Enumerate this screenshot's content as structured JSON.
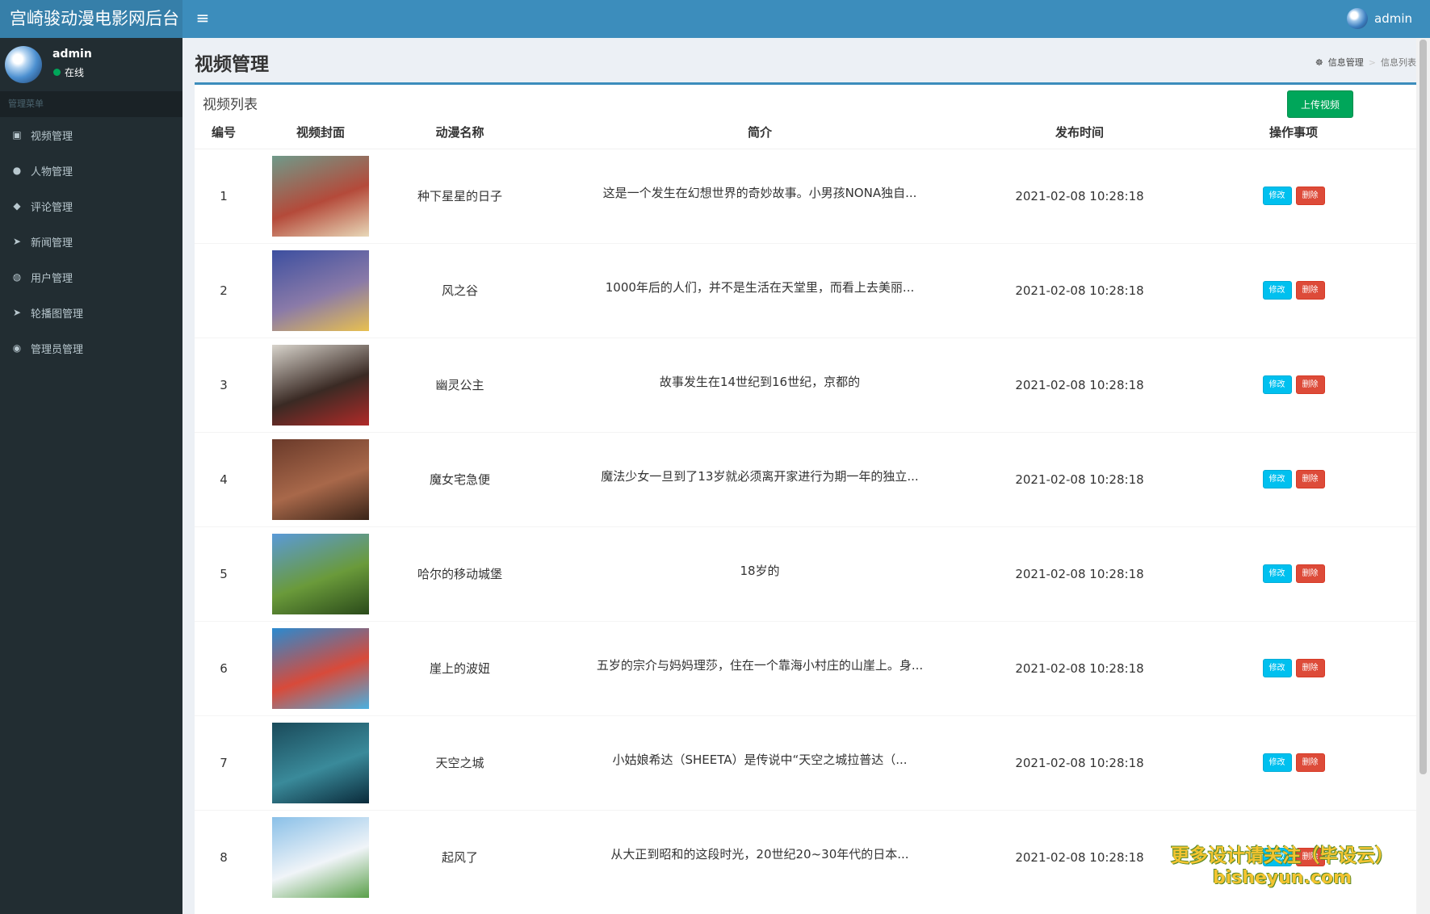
{
  "app": {
    "title": "宫崎骏动漫电影网后台"
  },
  "topbar": {
    "user_name": "admin"
  },
  "sidebar": {
    "user": {
      "name": "admin",
      "status": "在线"
    },
    "menu_header": "管理菜单",
    "items": [
      {
        "label": "视频管理",
        "icon": "film-icon",
        "glyph": "▣"
      },
      {
        "label": "人物管理",
        "icon": "user-icon",
        "glyph": "●"
      },
      {
        "label": "评论管理",
        "icon": "comments-icon",
        "glyph": "◆"
      },
      {
        "label": "新闻管理",
        "icon": "paper-plane-icon",
        "glyph": "➤"
      },
      {
        "label": "用户管理",
        "icon": "users-icon",
        "glyph": "◍"
      },
      {
        "label": "轮播图管理",
        "icon": "paper-plane-icon",
        "glyph": "➤"
      },
      {
        "label": "管理员管理",
        "icon": "user-circle-icon",
        "glyph": "◉"
      }
    ]
  },
  "page": {
    "title": "视频管理",
    "breadcrumb": [
      "信息管理",
      "信息列表"
    ]
  },
  "box": {
    "title": "视频列表",
    "upload_label": "上传视频"
  },
  "table": {
    "headers": [
      "编号",
      "视频封面",
      "动漫名称",
      "简介",
      "发布时间",
      "操作事项"
    ],
    "edit_label": "修改",
    "delete_label": "删除",
    "rows": [
      {
        "id": "1",
        "name": "种下星星的日子",
        "intro": "这是一个发生在幻想世界的奇妙故事。小男孩NONA独自...",
        "time": "2021-02-08 10:28:18",
        "cover_colors": [
          "#6f9a8a",
          "#b44a3a",
          "#e8d8b8"
        ]
      },
      {
        "id": "2",
        "name": "风之谷",
        "intro": "1000年后的人们，并不是生活在天堂里，而看上去美丽...",
        "time": "2021-02-08 10:28:18",
        "cover_colors": [
          "#3c4fa0",
          "#8a7aa8",
          "#e8c050"
        ]
      },
      {
        "id": "3",
        "name": "幽灵公主",
        "intro": "故事发生在14世纪到16世纪，京都的",
        "time": "2021-02-08 10:28:18",
        "cover_colors": [
          "#d8d4cc",
          "#3a2a24",
          "#b02a28"
        ]
      },
      {
        "id": "4",
        "name": "魔女宅急便",
        "intro": "魔法少女一旦到了13岁就必须离开家进行为期一年的独立...",
        "time": "2021-02-08 10:28:18",
        "cover_colors": [
          "#6a3a2a",
          "#a8684a",
          "#3a2418"
        ]
      },
      {
        "id": "5",
        "name": "哈尔的移动城堡",
        "intro": "18岁的",
        "time": "2021-02-08 10:28:18",
        "cover_colors": [
          "#5a9ad8",
          "#6a9a3a",
          "#2a4a1a"
        ]
      },
      {
        "id": "6",
        "name": "崖上的波妞",
        "intro": "五岁的宗介与妈妈理莎，住在一个靠海小村庄的山崖上。身...",
        "time": "2021-02-08 10:28:18",
        "cover_colors": [
          "#2a8ad0",
          "#d84a3a",
          "#4ab0e0"
        ]
      },
      {
        "id": "7",
        "name": "天空之城",
        "intro": "小姑娘希达（SHEETA）是传说中“天空之城拉普达（...",
        "time": "2021-02-08 10:28:18",
        "cover_colors": [
          "#1a4a5a",
          "#3a8a9a",
          "#0a2a3a"
        ]
      },
      {
        "id": "8",
        "name": "起风了",
        "intro": "从大正到昭和的这段时光，20世纪20~30年代的日本...",
        "time": "2021-02-08 10:28:18",
        "cover_colors": [
          "#8ac0e8",
          "#f0f4f8",
          "#5aa04a"
        ]
      }
    ]
  },
  "watermark": {
    "line1": "更多设计请关注（毕设云）",
    "line2": "bisheyun.com"
  },
  "colors": {
    "header": "#3c8dbc",
    "logo": "#367fa9",
    "sidebar": "#222d32",
    "success": "#00a65a",
    "info": "#00c0ef",
    "danger": "#dd4b39"
  }
}
